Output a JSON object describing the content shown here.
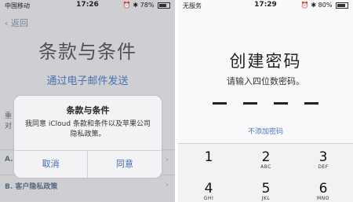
{
  "left_screen": {
    "status": {
      "carrier": "中国移动",
      "time": "17:26",
      "battery": "78%"
    },
    "back_label": "返回",
    "title": "条款与条件",
    "email_link": "通过电子邮件发送",
    "bg_text_1": "重",
    "bg_text_2": "对",
    "rows": [
      {
        "label": "A."
      },
      {
        "label": "B. 客户隐私政策"
      }
    ],
    "alert": {
      "title": "条款与条件",
      "message": "我同意 iCloud 条款和条件以及苹果公司隐私政策。",
      "cancel_label": "取消",
      "agree_label": "同意"
    }
  },
  "right_screen": {
    "status": {
      "carrier": "无服务",
      "time": "17:29",
      "battery": "80%"
    },
    "title": "创建密码",
    "prompt": "请输入四位数密码。",
    "no_passcode_link": "不添加密码",
    "keys": [
      {
        "num": "1",
        "letters": ""
      },
      {
        "num": "2",
        "letters": "ABC"
      },
      {
        "num": "3",
        "letters": "DEF"
      },
      {
        "num": "4",
        "letters": "GHI"
      },
      {
        "num": "5",
        "letters": "JKL"
      },
      {
        "num": "6",
        "letters": "MNO"
      }
    ]
  }
}
